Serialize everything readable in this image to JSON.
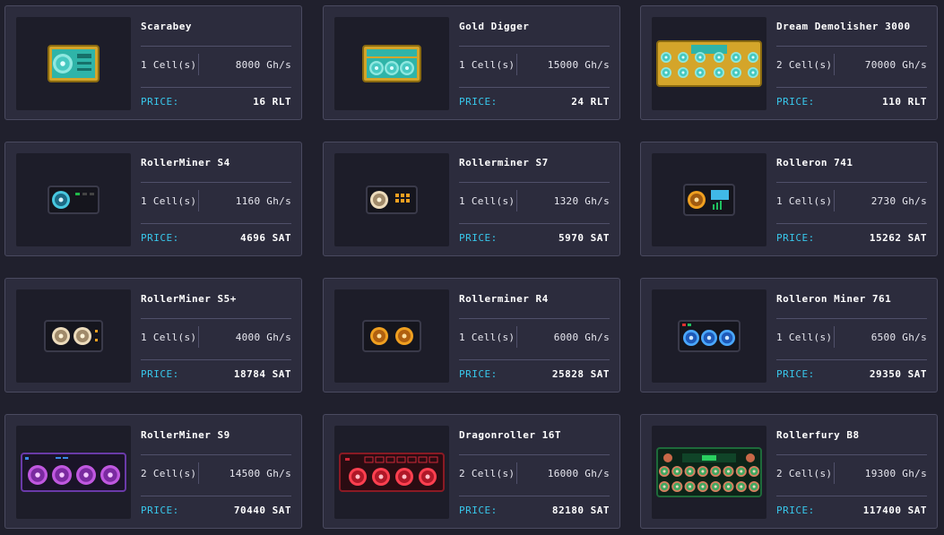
{
  "price_label": "PRICE:",
  "miners": [
    {
      "name": "Scarabey",
      "cells": "1 Cell(s)",
      "power": "8000 Gh/s",
      "price": "16 RLT",
      "icon": "scarabey-miner-icon",
      "style": "gold-1"
    },
    {
      "name": "Gold Digger",
      "cells": "1 Cell(s)",
      "power": "15000 Gh/s",
      "price": "24 RLT",
      "icon": "gold-digger-miner-icon",
      "style": "gold-3"
    },
    {
      "name": "Dream Demolisher 3000",
      "cells": "2 Cell(s)",
      "power": "70000 Gh/s",
      "price": "110 RLT",
      "icon": "dream-demolisher-miner-icon",
      "style": "gold-big"
    },
    {
      "name": "RollerMiner S4",
      "cells": "1 Cell(s)",
      "power": "1160 Gh/s",
      "price": "4696 SAT",
      "icon": "rollerminer-s4-miner-icon",
      "style": "dark-1-cyan"
    },
    {
      "name": "Rollerminer S7",
      "cells": "1 Cell(s)",
      "power": "1320 Gh/s",
      "price": "5970 SAT",
      "icon": "rollerminer-s7-miner-icon",
      "style": "dark-1-cream"
    },
    {
      "name": "Rolleron 741",
      "cells": "1 Cell(s)",
      "power": "2730 Gh/s",
      "price": "15262 SAT",
      "icon": "rolleron-741-miner-icon",
      "style": "dark-1-orange"
    },
    {
      "name": "RollerMiner S5+",
      "cells": "1 Cell(s)",
      "power": "4000 Gh/s",
      "price": "18784 SAT",
      "icon": "rollerminer-s5plus-miner-icon",
      "style": "dark-2-cream"
    },
    {
      "name": "Rollerminer R4",
      "cells": "1 Cell(s)",
      "power": "6000 Gh/s",
      "price": "25828 SAT",
      "icon": "rollerminer-r4-miner-icon",
      "style": "dark-2-orange"
    },
    {
      "name": "Rolleron Miner 761",
      "cells": "1 Cell(s)",
      "power": "6500 Gh/s",
      "price": "29350 SAT",
      "icon": "rolleron-miner-761-miner-icon",
      "style": "dark-3-blue"
    },
    {
      "name": "RollerMiner S9",
      "cells": "2 Cell(s)",
      "power": "14500 Gh/s",
      "price": "70440 SAT",
      "icon": "rollerminer-s9-miner-icon",
      "style": "purple-4"
    },
    {
      "name": "Dragonroller 16T",
      "cells": "2 Cell(s)",
      "power": "16000 Gh/s",
      "price": "82180 SAT",
      "icon": "dragonroller-16t-miner-icon",
      "style": "red-4"
    },
    {
      "name": "Rollerfury B8",
      "cells": "2 Cell(s)",
      "power": "19300 Gh/s",
      "price": "117400 SAT",
      "icon": "rollerfury-b8-miner-icon",
      "style": "green-8"
    }
  ],
  "colors": {
    "background": "#20202d",
    "card": "#2c2c3d",
    "card_border": "#4a4a60",
    "price_label": "#38c8ec",
    "text": "#ffffff"
  }
}
